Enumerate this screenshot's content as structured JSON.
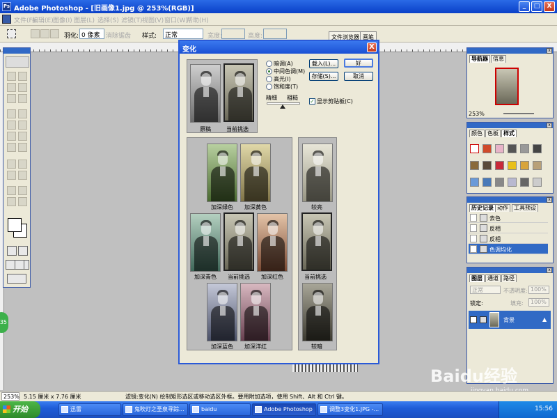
{
  "titlebar": {
    "title": "Adobe Photoshop - [旧画像1.jpg @ 253%(RGB)]",
    "min": "_",
    "max": "□",
    "close": "X"
  },
  "menu": {
    "items": [
      "文件(F)",
      "编辑(E)",
      "图像(I)",
      "图层(L)",
      "选择(S)",
      "滤镜(T)",
      "视图(V)",
      "窗口(W)",
      "帮助(H)"
    ]
  },
  "options": {
    "feather_label": "羽化:",
    "feather_value": "0 像素",
    "antialias": "消除锯齿",
    "style_label": "样式:",
    "style_value": "正常",
    "width_label": "宽度:",
    "height_label": "高度:",
    "tab_browser": "文件浏览器",
    "tab_brush": "画笔"
  },
  "dialog": {
    "title": "变化",
    "close": "X",
    "original_label": "原稿",
    "current_label": "当前挑选",
    "radios": [
      "暗调(A)",
      "中间色调(M)",
      "高光(I)",
      "饱和度(T)"
    ],
    "selected_radio": "中间色调(M)",
    "fine": "精细",
    "coarse": "粗糙",
    "show_clipping": "显示剪贴板(C)",
    "show_clipping_checked": true,
    "buttons": {
      "ok": "好",
      "cancel": "取消",
      "load": "载入(L)...",
      "save": "存储(S)..."
    },
    "variations": {
      "more_green": "加深绿色",
      "more_yellow": "加深黄色",
      "more_cyan": "加深青色",
      "current": "当前挑选",
      "more_red": "加深红色",
      "more_blue": "加深蓝色",
      "more_magenta": "加深洋红"
    },
    "brightness": {
      "lighter": "较亮",
      "current": "当前挑选",
      "darker": "较暗"
    }
  },
  "navigator": {
    "tabs": [
      "导航器",
      "信息"
    ],
    "zoom": "253%"
  },
  "color_palette": {
    "tabs": [
      "颜色",
      "色板",
      "样式"
    ]
  },
  "history": {
    "tabs": [
      "历史记录",
      "动作",
      "工具预设"
    ],
    "items": [
      "去色",
      "反相",
      "反相",
      "色调均化"
    ],
    "selected": "色调均化"
  },
  "layers": {
    "tabs": [
      "图层",
      "通道",
      "路径"
    ],
    "mode": "正常",
    "opacity_label": "不透明度:",
    "opacity": "100%",
    "lock_label": "锁定:",
    "fill_label": "填充:",
    "fill": "100%",
    "layer_name": "背景"
  },
  "status": {
    "zoom": "253%",
    "doc_size": "5.15 厘米 x 7.76 厘米",
    "hint": "滤镜:变化(N)  绘制矩形选区或移动选区外框。要用附加选项，使用 Shift、Alt 和 Ctrl 键。"
  },
  "taskbar": {
    "start": "开始",
    "tasks": [
      "迅雷",
      "鬼吹灯之圣泉寻踪...",
      "baidu",
      "Adobe Photoshop",
      "调整3变化1.JPG -..."
    ],
    "active_task": "Adobe Photoshop",
    "time": "15:56"
  },
  "watermark": {
    "logo": "Baidu经验",
    "url": "jingyan.baidu.com"
  },
  "colors": {
    "xp_blue": "#1a50d4",
    "selection_blue": "#316ac5",
    "green_tint": "#6e8a4a",
    "yellow_tint": "#a89a5a",
    "cyan_tint": "#5a8a7a",
    "red_tint": "#a46c4c",
    "blue_tint": "#5a6a8c",
    "magenta_tint": "#8c5a6c"
  },
  "icons": [
    "photoshop-icon",
    "marquee-icon",
    "move-icon",
    "lasso-icon",
    "magic-wand-icon",
    "crop-icon",
    "brush-icon",
    "stamp-icon",
    "eraser-icon",
    "gradient-icon",
    "text-icon",
    "hand-icon",
    "zoom-icon",
    "close-icon",
    "eye-icon",
    "start-flag-icon"
  ]
}
